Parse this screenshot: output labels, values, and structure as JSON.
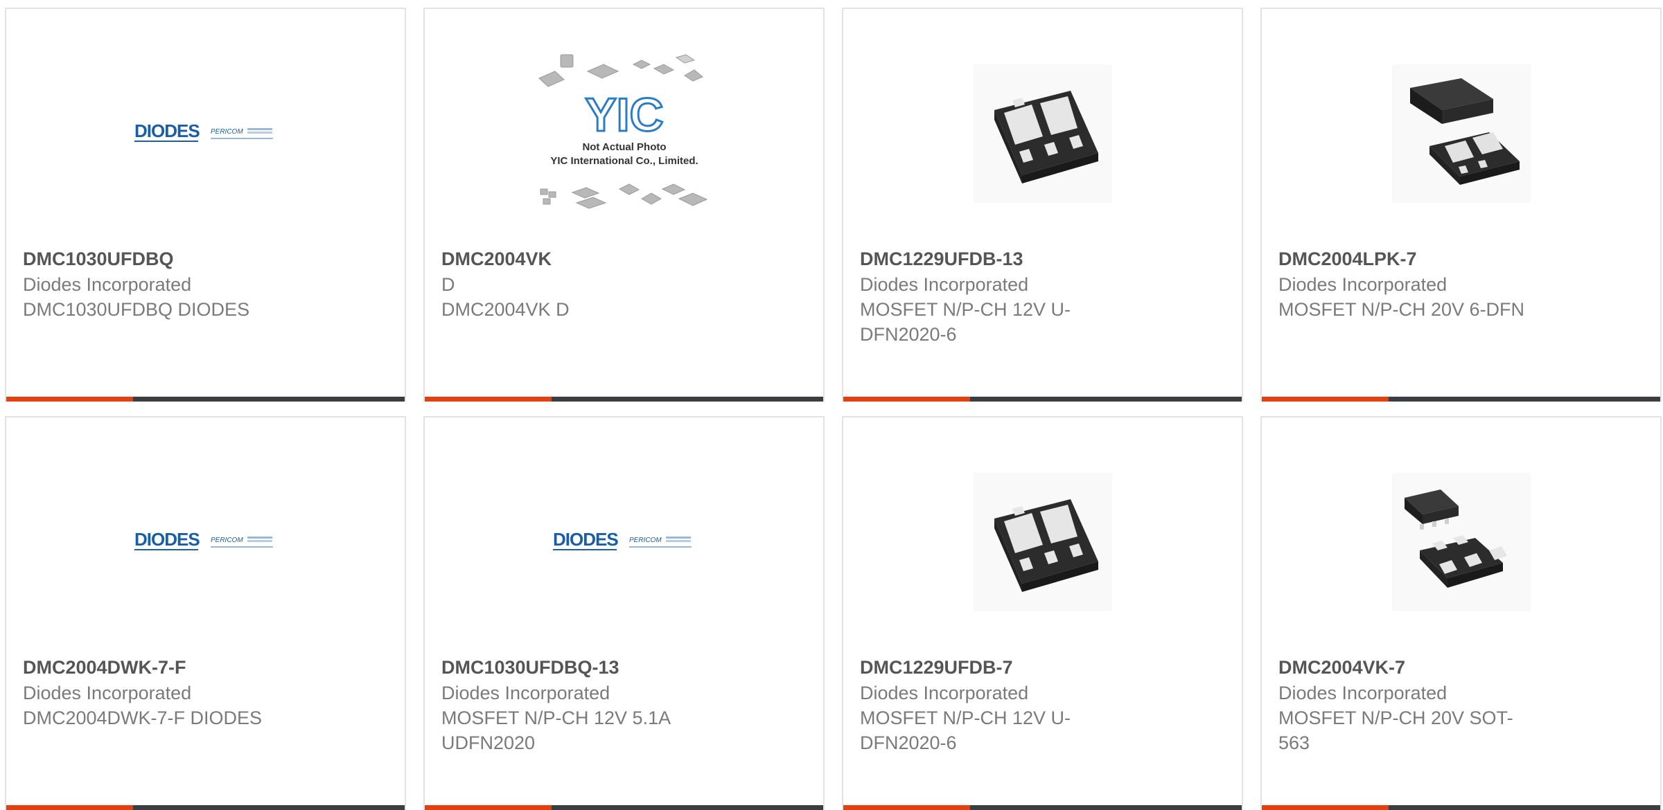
{
  "colors": {
    "accent": "#e2400f",
    "bar_dark": "#3b3d40",
    "card_border": "#e3e3e3",
    "title": "#555555",
    "text": "#7a7a7a",
    "diodes_blue": "#1a5ea8"
  },
  "logos": {
    "diodes_word": "DIODES",
    "pericom_word": "PERICOM",
    "yic_mark": "YIC",
    "yic_line1": "Not Actual Photo",
    "yic_line2": "YIC International Co., Limited."
  },
  "products": [
    {
      "part_number": "DMC1030UFDBQ",
      "manufacturer": "Diodes Incorporated",
      "description": "DMC1030UFDBQ DIODES",
      "image": "diodes-pericom-logo"
    },
    {
      "part_number": "DMC2004VK",
      "manufacturer": "D",
      "description": "DMC2004VK D",
      "image": "yic-not-actual-photo"
    },
    {
      "part_number": "DMC1229UFDB-13",
      "manufacturer": "Diodes Incorporated",
      "description": "MOSFET N/P-CH 12V U-DFN2020-6",
      "image": "dfn-package-photo"
    },
    {
      "part_number": "DMC2004LPK-7",
      "manufacturer": "Diodes Incorporated",
      "description": "MOSFET N/P-CH 20V 6-DFN",
      "image": "dfn-two-package-photo"
    },
    {
      "part_number": "DMC2004DWK-7-F",
      "manufacturer": "Diodes Incorporated",
      "description": "DMC2004DWK-7-F DIODES",
      "image": "diodes-pericom-logo"
    },
    {
      "part_number": "DMC1030UFDBQ-13",
      "manufacturer": "Diodes Incorporated",
      "description": "MOSFET N/P-CH 12V 5.1A UDFN2020",
      "image": "diodes-pericom-logo"
    },
    {
      "part_number": "DMC1229UFDB-7",
      "manufacturer": "Diodes Incorporated",
      "description": "MOSFET N/P-CH 12V U-DFN2020-6",
      "image": "dfn-package-photo"
    },
    {
      "part_number": "DMC2004VK-7",
      "manufacturer": "Diodes Incorporated",
      "description": "MOSFET N/P-CH 20V SOT-563",
      "image": "sot563-package-photo"
    }
  ]
}
